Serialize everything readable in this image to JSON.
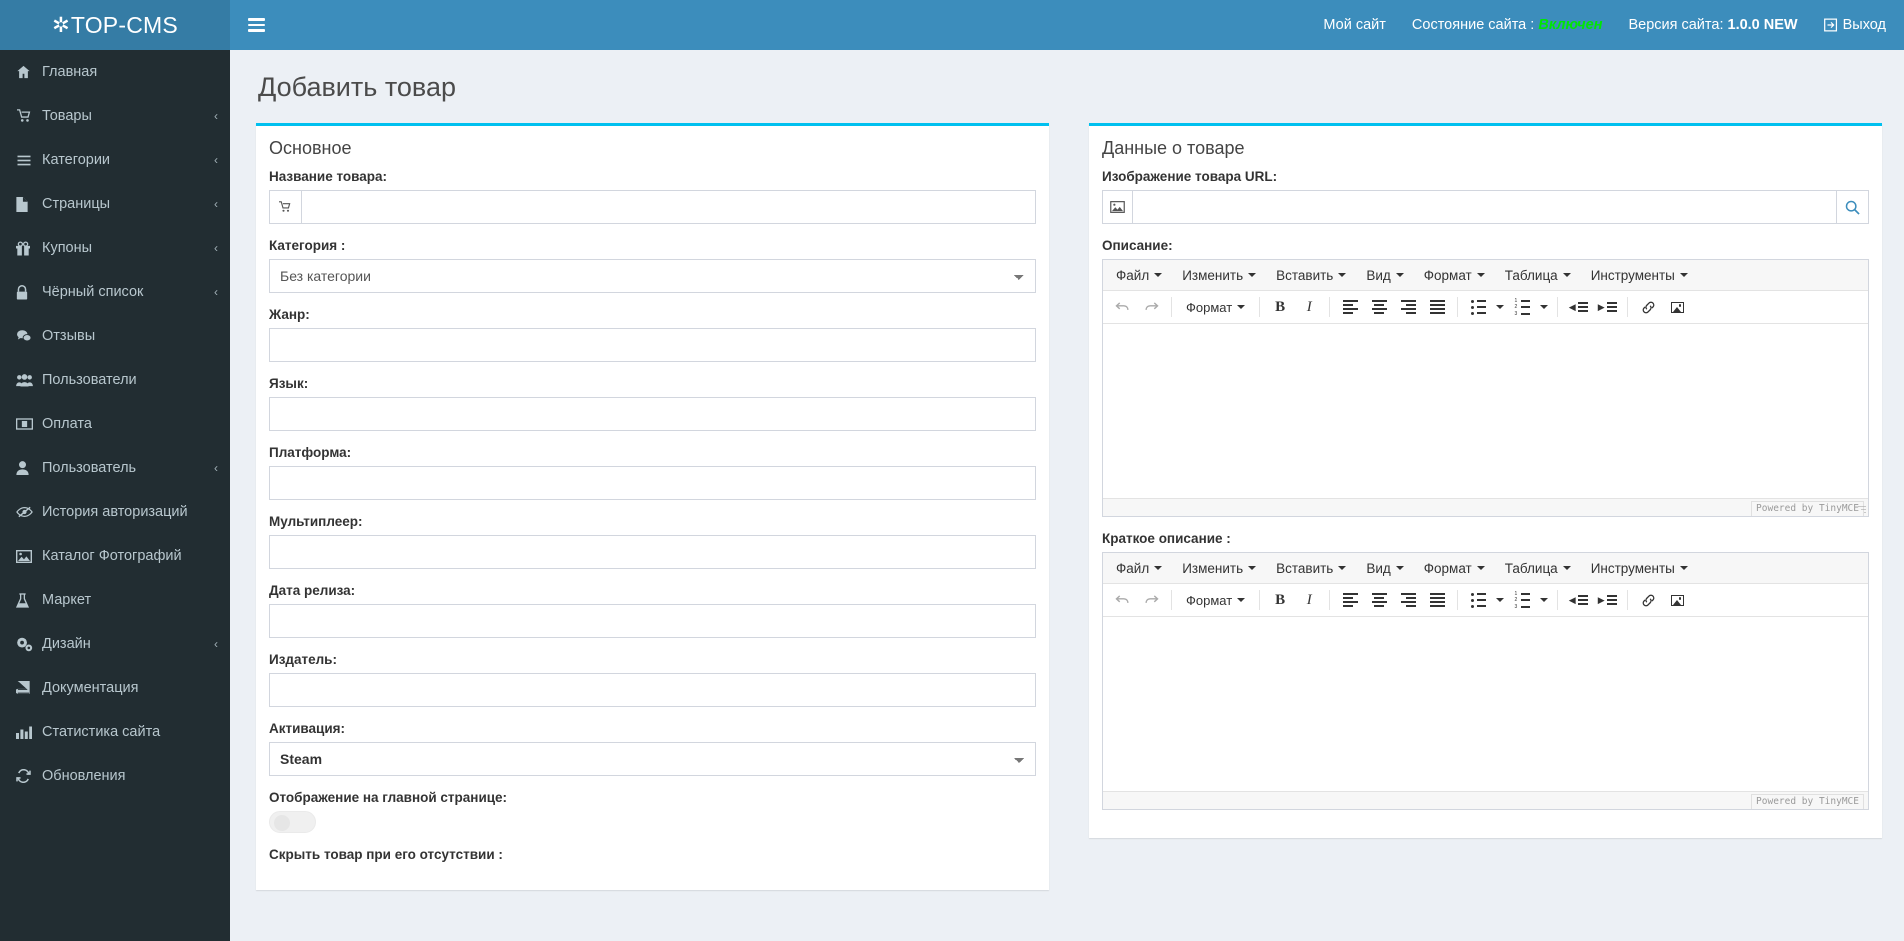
{
  "brand": {
    "logo_icon": "cog-icon",
    "title": "TOP-CMS"
  },
  "navbar": {
    "toggle_icon": "hamburger-icon",
    "my_site": "Мой сайт",
    "site_state_label": "Состояние сайта :",
    "site_state_value": "Включен",
    "site_state_color": "#00e605",
    "version_label": "Версия сайта:",
    "version_value": "1.0.0 NEW",
    "logout_icon": "logout-icon",
    "logout": "Выход"
  },
  "sidebar": {
    "items": [
      {
        "label": "Главная",
        "icon": "home-icon",
        "arrow": ""
      },
      {
        "label": "Товары",
        "icon": "cart-icon",
        "arrow": "‹"
      },
      {
        "label": "Категории",
        "icon": "list-icon",
        "arrow": "‹"
      },
      {
        "label": "Страницы",
        "icon": "file-icon",
        "arrow": "‹"
      },
      {
        "label": "Купоны",
        "icon": "gift-icon",
        "arrow": "‹"
      },
      {
        "label": "Чёрный список",
        "icon": "lock-icon",
        "arrow": "‹"
      },
      {
        "label": "Отзывы",
        "icon": "comments-icon",
        "arrow": ""
      },
      {
        "label": "Пользователи",
        "icon": "users-icon",
        "arrow": ""
      },
      {
        "label": "Оплата",
        "icon": "money-icon",
        "arrow": ""
      },
      {
        "label": "Пользователь",
        "icon": "user-icon",
        "arrow": "‹"
      },
      {
        "label": "История авторизаций",
        "icon": "eye-slash-icon",
        "arrow": ""
      },
      {
        "label": "Каталог Фотографий",
        "icon": "picture-icon",
        "arrow": ""
      },
      {
        "label": "Маркет",
        "icon": "flask-icon",
        "arrow": ""
      },
      {
        "label": "Дизайн",
        "icon": "gears-icon",
        "arrow": "‹"
      },
      {
        "label": "Документация",
        "icon": "book-icon",
        "arrow": ""
      },
      {
        "label": "Статистика сайта",
        "icon": "bar-chart-icon",
        "arrow": ""
      },
      {
        "label": "Обновления",
        "icon": "refresh-icon",
        "arrow": ""
      }
    ]
  },
  "page": {
    "title": "Добавить товар",
    "accent_color": "#00c0ef"
  },
  "left_panel": {
    "title": "Основное",
    "fields": {
      "name_label": "Название товара:",
      "name_addon_icon": "cart-icon",
      "name_value": "",
      "category_label": "Категория :",
      "category_value": "Без категории",
      "category_options": [
        "Без категории"
      ],
      "genre_label": "Жанр:",
      "genre_value": "",
      "language_label": "Язык:",
      "language_value": "",
      "platform_label": "Платформа:",
      "platform_value": "",
      "multiplayer_label": "Мультиплеер:",
      "multiplayer_value": "",
      "release_date_label": "Дата релиза:",
      "release_date_value": "",
      "publisher_label": "Издатель:",
      "publisher_value": "",
      "activation_label": "Активация:",
      "activation_value": "Steam",
      "activation_options": [
        "Steam"
      ],
      "mainpage_label": "Отображение на главной странице:",
      "mainpage_state": "off",
      "hide_label": "Скрыть товар при его отсутствии :"
    }
  },
  "right_panel": {
    "title": "Данные о товаре",
    "image_url_label": "Изображение товара URL:",
    "image_url_value": "",
    "image_addon_icon": "picture-icon",
    "image_search_icon": "search-icon",
    "description_label": "Описание:",
    "short_description_label": "Краткое описание :"
  },
  "editor": {
    "menubar": [
      {
        "label": "Файл"
      },
      {
        "label": "Изменить"
      },
      {
        "label": "Вставить"
      },
      {
        "label": "Вид"
      },
      {
        "label": "Формат"
      },
      {
        "label": "Таблица"
      },
      {
        "label": "Инструменты"
      }
    ],
    "toolbar": {
      "undo_icon": "undo-icon",
      "redo_icon": "redo-icon",
      "format_label": "Формат",
      "bold_label": "B",
      "italic_label": "I",
      "align_left_icon": "align-left-icon",
      "align_center_icon": "align-center-icon",
      "align_right_icon": "align-right-icon",
      "align_justify_icon": "align-justify-icon",
      "bullist_icon": "bullet-list-icon",
      "numlist_icon": "numbered-list-icon",
      "outdent_icon": "outdent-icon",
      "indent_icon": "indent-icon",
      "link_icon": "link-icon",
      "image_icon": "image-icon"
    },
    "branding": "Powered by TinyMCE",
    "content": ""
  }
}
